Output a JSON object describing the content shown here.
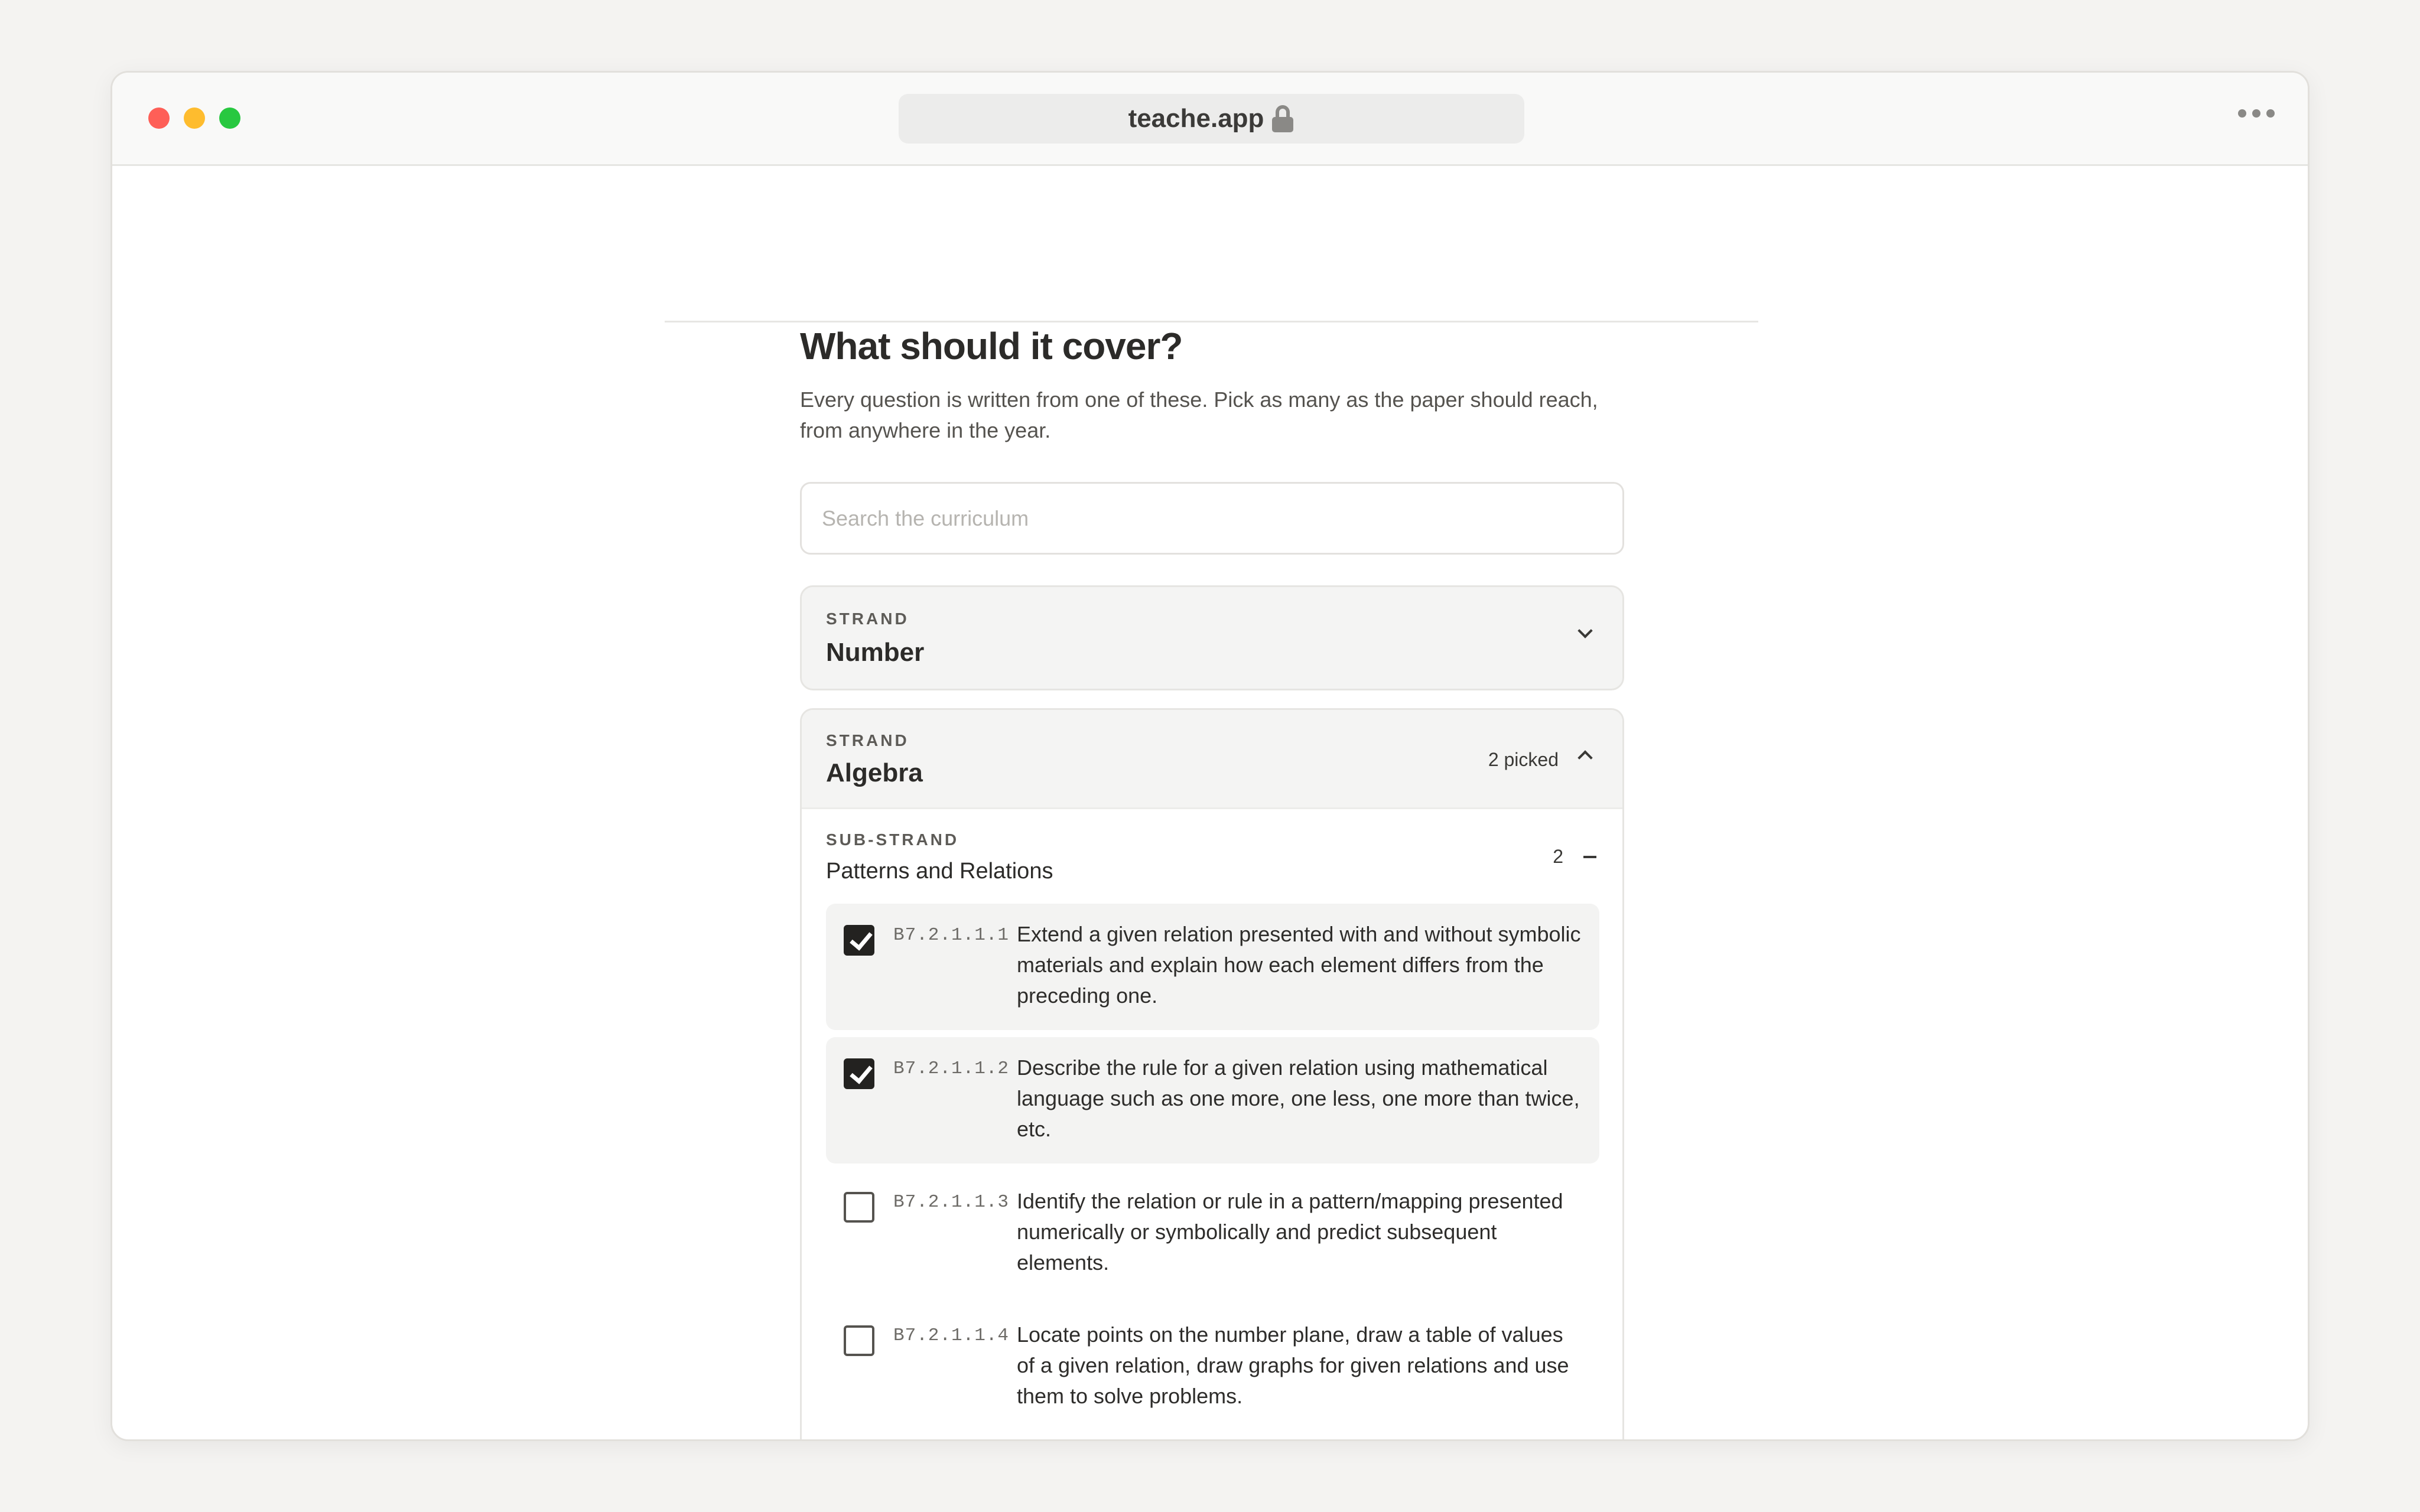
{
  "browser": {
    "url": "teache.app"
  },
  "page": {
    "heading": "What should it cover?",
    "description": "Every question is written from one of these. Pick as many as the paper should reach, from anywhere in the year."
  },
  "search": {
    "placeholder": "Search the curriculum",
    "value": ""
  },
  "strands": [
    {
      "eyebrow": "STRAND",
      "name": "Number",
      "expanded": false
    },
    {
      "eyebrow": "STRAND",
      "name": "Algebra",
      "picked_label": "2 picked",
      "expanded": true,
      "substrand": {
        "eyebrow": "SUB-STRAND",
        "name": "Patterns and Relations",
        "count": "2",
        "toggle": "–",
        "outcomes": [
          {
            "code": "B7.2.1.1.1",
            "text": "Extend a given relation presented with and without symbolic materials and explain how each element differs from the preceding one.",
            "checked": true
          },
          {
            "code": "B7.2.1.1.2",
            "text": "Describe the rule for a given relation using mathematical language such as one more, one less, one more than twice, etc.",
            "checked": true
          },
          {
            "code": "B7.2.1.1.3",
            "text": "Identify the relation or rule in a pattern/mapping presented numerically or symbolically and predict subsequent elements.",
            "checked": false
          },
          {
            "code": "B7.2.1.1.4",
            "text": "Locate points on the number plane, draw a table of values of a given relation, draw graphs for given relations and use them to solve problems.",
            "checked": false
          }
        ]
      }
    }
  ],
  "colors": {
    "checkbox_checked": "#232220",
    "traffic_red": "#fe5f57",
    "traffic_yellow": "#febc2e",
    "traffic_green": "#28c840"
  }
}
